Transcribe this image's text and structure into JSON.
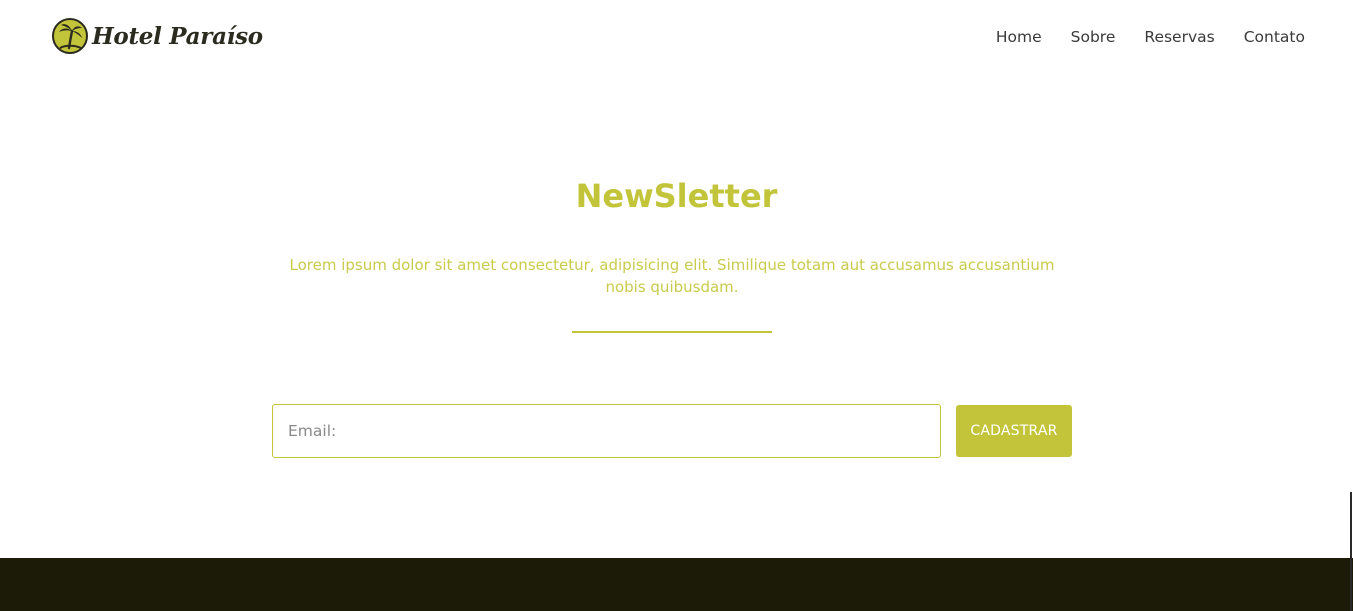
{
  "brand": {
    "name": "Hotel Paraíso",
    "logo_icon": "palm-tree-icon",
    "colors": {
      "accent": "#c2c43a",
      "dark": "#1b1b08"
    }
  },
  "nav": {
    "items": [
      {
        "label": "Home"
      },
      {
        "label": "Sobre"
      },
      {
        "label": "Reservas"
      },
      {
        "label": "Contato"
      }
    ]
  },
  "newsletter": {
    "title": "NewSletter",
    "description": "Lorem ipsum dolor sit amet consectetur, adipisicing elit. Similique totam aut accusamus accusantium nobis quibusdam.",
    "email_placeholder": "Email:",
    "email_value": "",
    "submit_label": "CADASTRAR"
  }
}
